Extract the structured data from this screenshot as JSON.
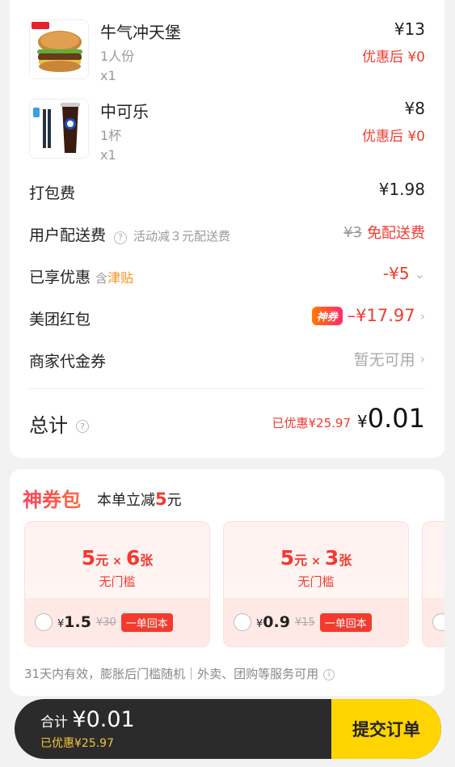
{
  "items": [
    {
      "name": "牛气冲天堡",
      "spec": "1人份",
      "qty": "x1",
      "price": "¥13",
      "discount": "优惠后 ¥0"
    },
    {
      "name": "中可乐",
      "spec": "1杯",
      "qty": "x1",
      "price": "¥8",
      "discount": "优惠后 ¥0"
    }
  ],
  "packing": {
    "label": "打包费",
    "value": "¥1.98"
  },
  "delivery": {
    "label": "用户配送费",
    "note": "活动减３元配送费",
    "original": "¥3",
    "value": "免配送费"
  },
  "discounts": {
    "label": "已享优惠",
    "sub_prefix": "含",
    "sub_highlight": "津贴",
    "value": "-¥5"
  },
  "redpacket": {
    "label": "美团红包",
    "badge": "神券",
    "value": "–¥17.97"
  },
  "merchant_coupon": {
    "label": "商家代金券",
    "value": "暂无可用"
  },
  "total": {
    "label": "总计",
    "saved": "已优惠¥25.97",
    "currency": "¥",
    "value": "0.01"
  },
  "coupon_pack": {
    "title": "神券包",
    "desc_prefix": "本单立减",
    "desc_amount": "5",
    "desc_unit": "元",
    "coupons": [
      {
        "amount": "5",
        "amount_unit": "元",
        "times": "×",
        "count": "6",
        "count_unit": "张",
        "threshold": "无门槛",
        "price_symbol": "¥",
        "price": "1.5",
        "old_price": "¥30",
        "tag": "一单回本"
      },
      {
        "amount": "5",
        "amount_unit": "元",
        "times": "×",
        "count": "3",
        "count_unit": "张",
        "threshold": "无门槛",
        "price_symbol": "¥",
        "price": "0.9",
        "old_price": "¥15",
        "tag": "一单回本"
      }
    ],
    "note": "31天内有效，膨胀后门槛随机｜外卖、团购等服务可用"
  },
  "bottom_bar": {
    "total_label": "合计 ",
    "total_value": "¥0.01",
    "saved": "已优惠¥25.97",
    "submit": "提交订单"
  },
  "colors": {
    "accent_red": "#f23a2f",
    "submit_yellow": "#ffd400",
    "bar_dark": "#2b2b2b"
  },
  "icons": [
    "burger-image",
    "cola-image",
    "question-icon",
    "chevron-right-icon",
    "chevron-down-icon",
    "info-icon"
  ]
}
